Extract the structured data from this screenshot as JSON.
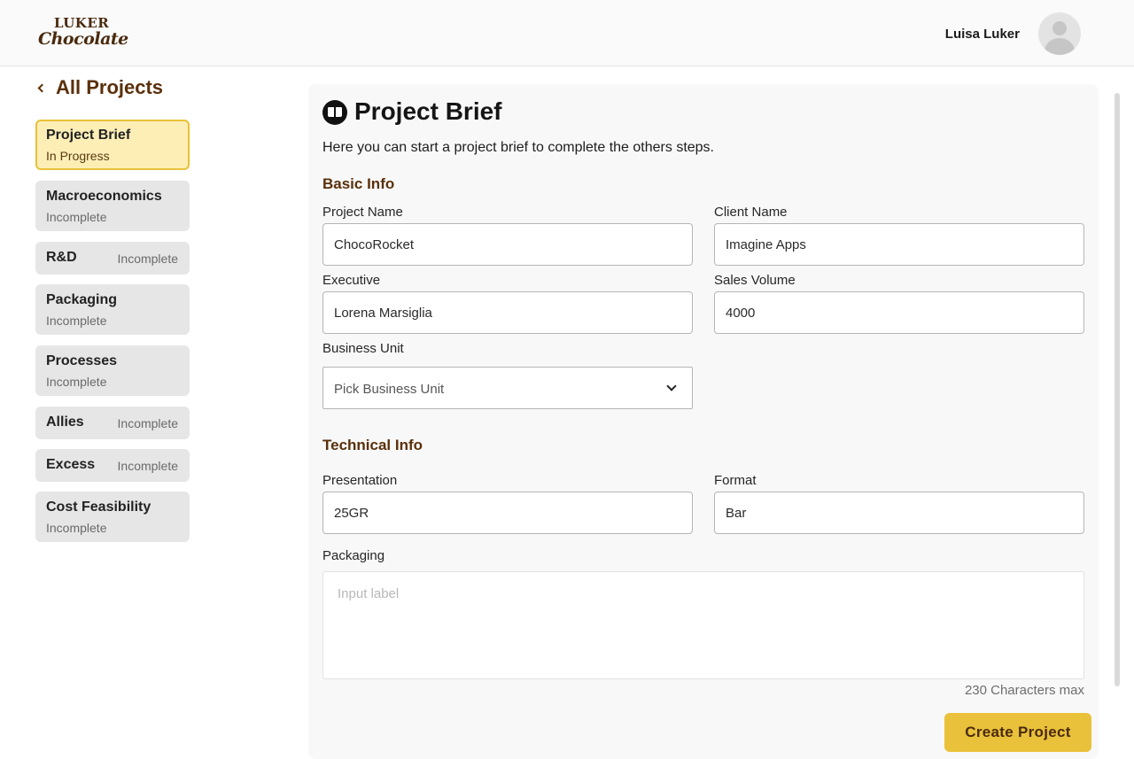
{
  "brand": {
    "logo_top": "LUKER",
    "logo_bottom": "Chocolate"
  },
  "header": {
    "user_name": "Luisa Luker",
    "avatar_icon": "user-avatar-icon"
  },
  "nav": {
    "back_label": "All Projects"
  },
  "steps": [
    {
      "title": "Project Brief",
      "status": "In Progress",
      "active": true
    },
    {
      "title": "Macroeconomics",
      "status": "Incomplete"
    },
    {
      "title": "R&D",
      "status": "Incomplete"
    },
    {
      "title": "Packaging",
      "status": "Incomplete"
    },
    {
      "title": "Processes",
      "status": "Incomplete"
    },
    {
      "title": "Allies",
      "status": "Incomplete"
    },
    {
      "title": "Excess",
      "status": "Incomplete"
    },
    {
      "title": "Cost Feasibility",
      "status": "Incomplete"
    }
  ],
  "main": {
    "icon": "book-open-icon",
    "title": "Project Brief",
    "intro": "Here you can start a project brief to complete the others steps.",
    "basic_info": {
      "heading": "Basic Info",
      "project_name": {
        "label": "Project Name",
        "value": "ChocoRocket"
      },
      "client_name": {
        "label": "Client Name",
        "value": "Imagine Apps"
      },
      "executive": {
        "label": "Executive",
        "value": "Lorena Marsiglia"
      },
      "sales_volume": {
        "label": "Sales Volume",
        "value": "4000"
      },
      "business_unit": {
        "label": "Business Unit",
        "value": "Pick Business Unit"
      }
    },
    "technical_info": {
      "heading": "Technical Info",
      "presentation": {
        "label": "Presentation",
        "value": "25GR"
      },
      "format": {
        "label": "Format",
        "value": "Bar"
      },
      "packaging": {
        "label": "Packaging",
        "placeholder": "Input label",
        "hint": "230 Characters max"
      }
    },
    "create_button": "Create Project"
  },
  "colors": {
    "accent": "#e9c13a",
    "brand_brown": "#5a300b",
    "active_step_bg": "#fdeeb6"
  }
}
